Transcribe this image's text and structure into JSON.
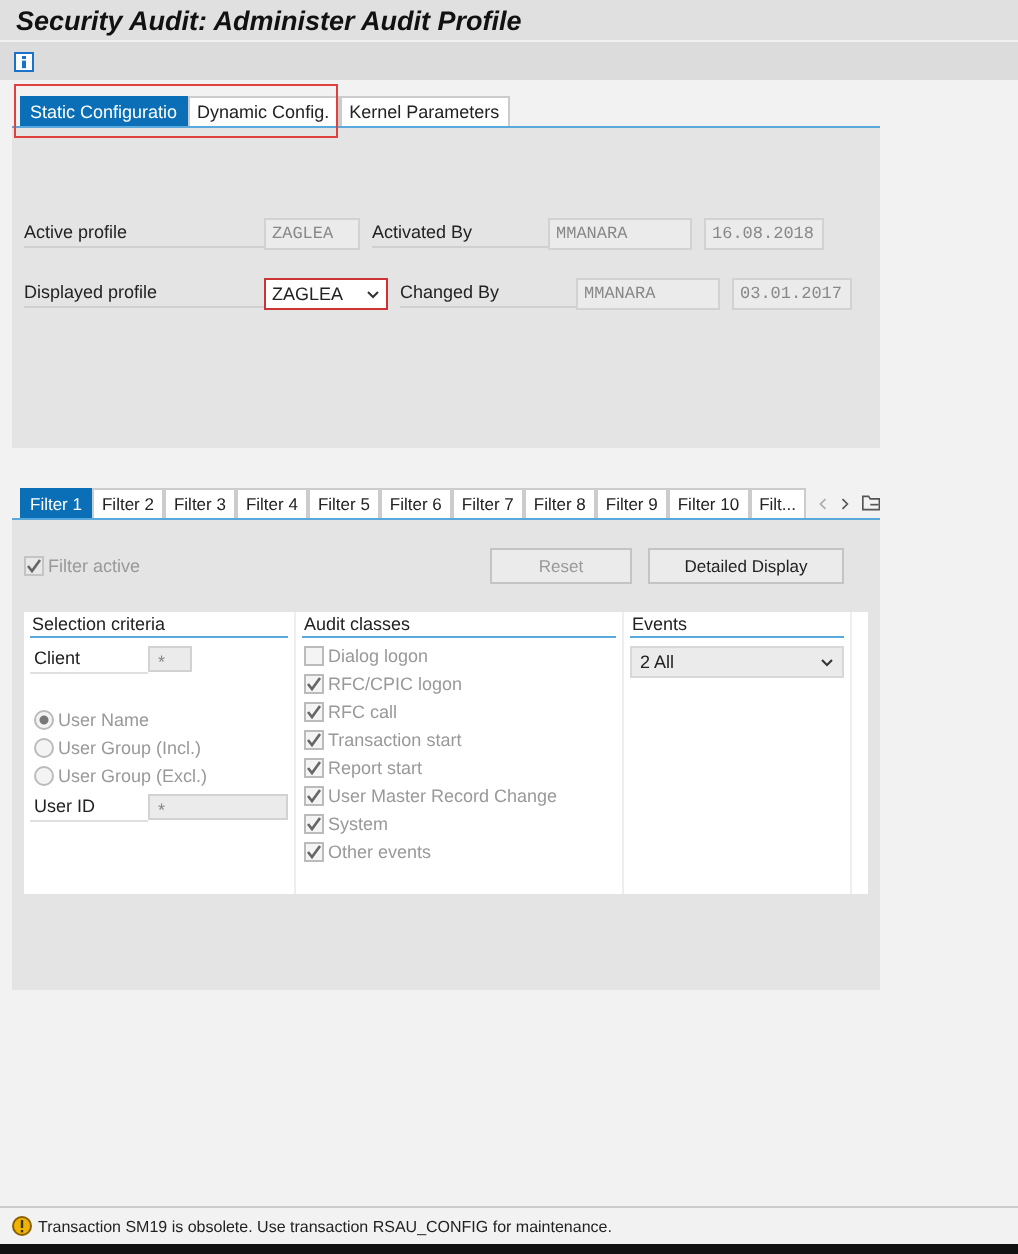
{
  "window": {
    "title": "Security Audit: Administer Audit Profile"
  },
  "tabs": [
    {
      "label": "Static Configuratio",
      "selected": true
    },
    {
      "label": "Dynamic Config.",
      "selected": false
    },
    {
      "label": "Kernel Parameters",
      "selected": false
    }
  ],
  "profile": {
    "active_profile": {
      "label": "Active profile",
      "value": "ZAGLEA"
    },
    "activated_by": {
      "label": "Activated By",
      "value": "MMANARA",
      "date": "16.08.2018"
    },
    "displayed_profile": {
      "label": "Displayed profile",
      "value": "ZAGLEA"
    },
    "changed_by": {
      "label": "Changed By",
      "value": "MMANARA",
      "date": "03.01.2017"
    }
  },
  "filter_tabs": [
    {
      "label": "Filter 1",
      "selected": true
    },
    {
      "label": "Filter 2",
      "selected": false
    },
    {
      "label": "Filter 3",
      "selected": false
    },
    {
      "label": "Filter 4",
      "selected": false
    },
    {
      "label": "Filter 5",
      "selected": false
    },
    {
      "label": "Filter 6",
      "selected": false
    },
    {
      "label": "Filter 7",
      "selected": false
    },
    {
      "label": "Filter 8",
      "selected": false
    },
    {
      "label": "Filter 9",
      "selected": false
    },
    {
      "label": "Filter 10",
      "selected": false
    },
    {
      "label": "Filt...",
      "selected": false
    }
  ],
  "filter_active": {
    "label": "Filter active",
    "checked": true,
    "disabled": true
  },
  "buttons": [
    {
      "label": "Reset",
      "disabled": true
    },
    {
      "label": "Detailed Display",
      "disabled": false
    }
  ],
  "selection_criteria": {
    "heading": "Selection criteria",
    "client": {
      "label": "Client",
      "value": "*"
    },
    "radios": [
      {
        "label": "User Name",
        "selected": true
      },
      {
        "label": "User Group (Incl.)",
        "selected": false
      },
      {
        "label": "User Group (Excl.)",
        "selected": false
      }
    ],
    "user_id": {
      "label": "User ID",
      "value": "*"
    }
  },
  "audit_classes": {
    "heading": "Audit classes",
    "items": [
      {
        "label": "Dialog logon",
        "checked": false
      },
      {
        "label": "RFC/CPIC logon",
        "checked": true
      },
      {
        "label": "RFC call",
        "checked": true
      },
      {
        "label": "Transaction start",
        "checked": true
      },
      {
        "label": "Report start",
        "checked": true
      },
      {
        "label": "User Master Record Change",
        "checked": true
      },
      {
        "label": "System",
        "checked": true
      },
      {
        "label": "Other events",
        "checked": true
      }
    ]
  },
  "events": {
    "heading": "Events",
    "value": "2 All"
  },
  "status_bar": {
    "message": "Transaction SM19 is obsolete. Use transaction RSAU_CONFIG for maintenance."
  }
}
